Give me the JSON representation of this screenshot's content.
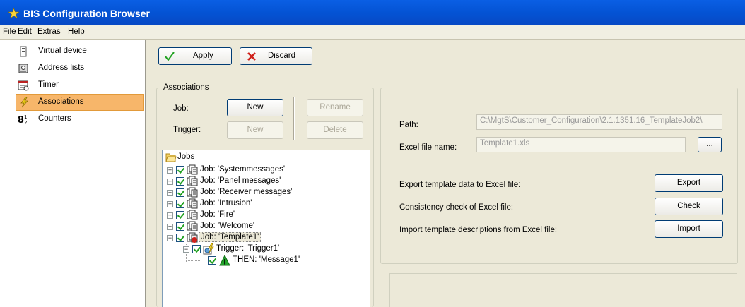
{
  "window": {
    "title": "BIS Configuration Browser"
  },
  "menu": [
    "File",
    "Edit",
    "Extras",
    "Help"
  ],
  "nav": {
    "items": [
      {
        "label": "Virtual device",
        "icon": "device-icon"
      },
      {
        "label": "Address lists",
        "icon": "address-list-icon"
      },
      {
        "label": "Timer",
        "icon": "timer-icon"
      },
      {
        "label": "Associations",
        "icon": "lightning-icon",
        "active": true
      },
      {
        "label": "Counters",
        "icon": "counter-icon"
      }
    ]
  },
  "toolbar": {
    "apply_label": "Apply",
    "discard_label": "Discard"
  },
  "associations": {
    "legend": "Associations",
    "job_label": "Job:",
    "trigger_label": "Trigger:",
    "job_new": "New",
    "trigger_new": "New",
    "rename": "Rename",
    "delete": "Delete",
    "tree": {
      "root": "Jobs",
      "jobs": [
        "Job: 'Systemmessages'",
        "Job: 'Panel messages'",
        "Job: 'Receiver messages'",
        "Job: 'Intrusion'",
        "Job: 'Fire'",
        "Job: 'Welcome'",
        "Job: 'Template1'"
      ],
      "trigger": "Trigger: 'Trigger1'",
      "action": "THEN: 'Message1'"
    }
  },
  "details": {
    "path_label": "Path:",
    "path_value": "C:\\MgtS\\Customer_Configuration\\2.1.1351.16_TemplateJob2\\",
    "excel_label": "Excel file name:",
    "excel_value": "Template1.xls",
    "browse_label": "...",
    "export_text": "Export template data to Excel file:",
    "export_button": "Export",
    "check_text": "Consistency check of Excel file:",
    "check_button": "Check",
    "import_text": "Import template descriptions from Excel file:",
    "import_button": "Import"
  }
}
